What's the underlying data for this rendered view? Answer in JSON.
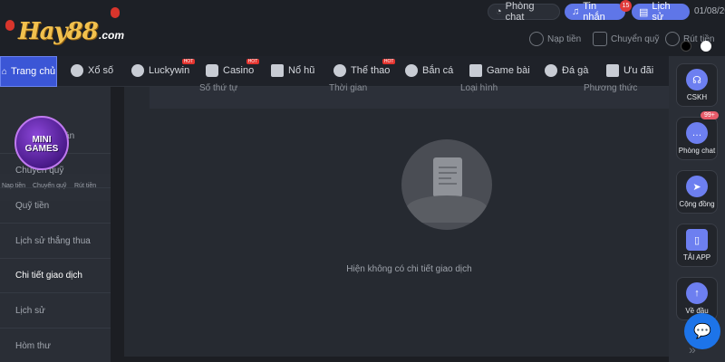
{
  "header": {
    "logo_text": "Hay88",
    "logo_suffix": ".com",
    "phong_chat": "Phòng chat",
    "tin_nhan": "Tin nhắn",
    "tin_nhan_badge": "15",
    "lich_su": "Lịch sử",
    "date": "01/08/20"
  },
  "account": {
    "deposit": "Nạp tiền",
    "transfer": "Chuyển quỹ",
    "withdraw": "Rút tiền"
  },
  "nav": {
    "home": "Trang chủ",
    "items": [
      {
        "label": "Xổ số",
        "hot": ""
      },
      {
        "label": "Luckywin",
        "hot": "HOT"
      },
      {
        "label": "Casino",
        "hot": "HOT"
      },
      {
        "label": "Nổ hũ",
        "hot": ""
      },
      {
        "label": "Thể thao",
        "hot": "HOT"
      },
      {
        "label": "Bắn cá",
        "hot": ""
      },
      {
        "label": "Game bài",
        "hot": ""
      },
      {
        "label": "Đá gà",
        "hot": ""
      },
      {
        "label": "Ưu đãi",
        "hot": ""
      }
    ]
  },
  "sidebar": {
    "mini": [
      "Nạp tiền",
      "Chuyển quỹ",
      "Rút tiền"
    ],
    "items": [
      {
        "label": "nhân"
      },
      {
        "label": "Chuyển quỹ"
      },
      {
        "label": "Quỹ tiền"
      },
      {
        "label": "Lịch sử thắng thua"
      },
      {
        "label": "Chi tiết giao dịch"
      },
      {
        "label": "Lịch sử"
      },
      {
        "label": "Hòm thư"
      }
    ],
    "minigames_label": "MINI GAMES"
  },
  "table": {
    "columns": [
      "Số thứ tự",
      "Thời gian",
      "Loại hình",
      "Phương thức"
    ],
    "empty_message": "Hiện không có chi tiết giao dịch"
  },
  "rail": {
    "items": [
      "CSKH",
      "Phòng chat",
      "Cộng đồng",
      "TẢI APP",
      "Về đầu"
    ],
    "badge": "99+"
  }
}
